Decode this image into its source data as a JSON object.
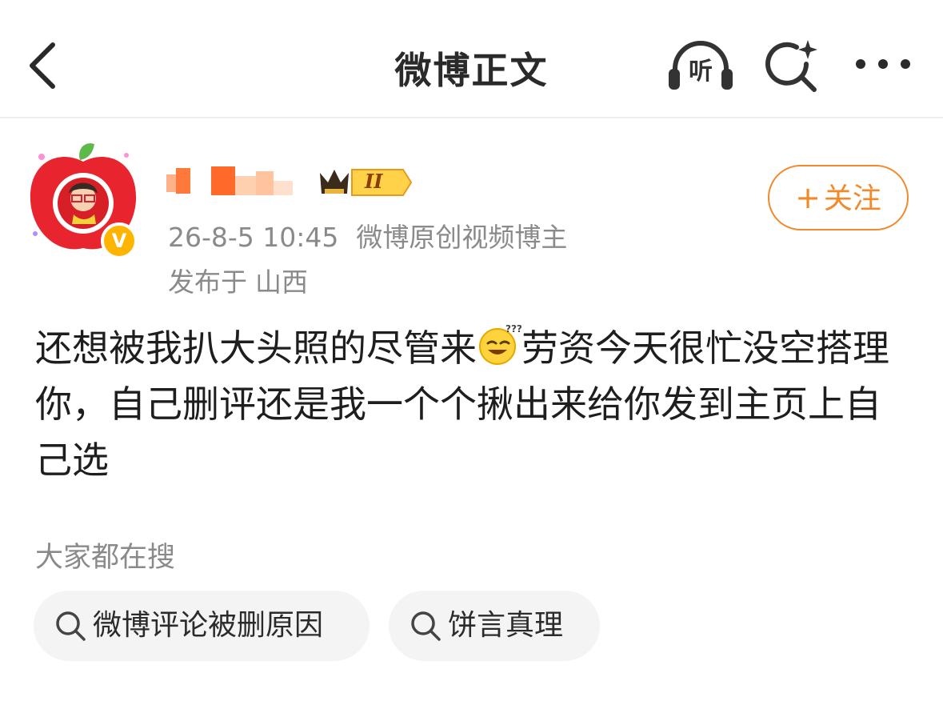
{
  "header": {
    "title": "微博正文",
    "listen_label": "听"
  },
  "author": {
    "verified_mark": "V",
    "level_badge": "II",
    "timestamp": "26-8-5 10:45",
    "role": "微博原创视频博主",
    "location_prefix": "发布于",
    "location": "山西",
    "follow_label": "关注"
  },
  "post": {
    "text_before_emoji": "还想被我扒大头照的尽管来",
    "text_after_emoji": "劳资今天很忙没空搭理你，自己删评还是我一个个揪出来给你发到主页上自己选"
  },
  "trending": {
    "section_label": "大家都在搜",
    "chips": [
      {
        "label": "微博评论被删原因"
      },
      {
        "label": "饼言真理"
      }
    ]
  },
  "colors": {
    "accent": "#f08a2a",
    "meta_gray": "#8a8a8a",
    "chip_background": "#f4f4f4",
    "verified_badge": "#ffb400"
  },
  "icons": {
    "back": "chevron-left-icon",
    "listen": "headphones-icon",
    "search": "sparkle-search-icon",
    "more": "more-dots-icon",
    "chip_search": "search-icon",
    "emoji": "thinking-grin-emoji"
  }
}
